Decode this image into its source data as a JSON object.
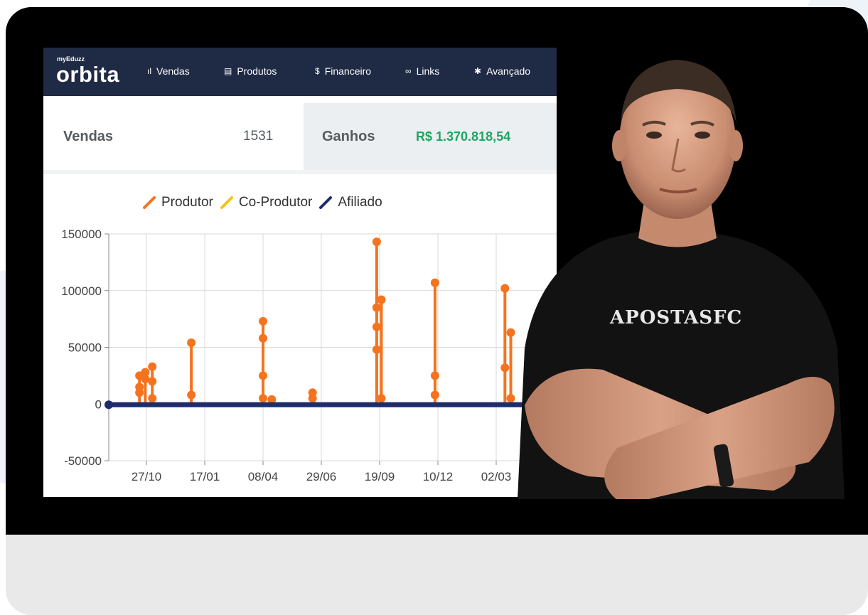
{
  "navbar": {
    "brand_small": "myEduzz",
    "brand": "orbita",
    "items": [
      {
        "icon": "bar-chart-icon",
        "glyph": "ıl",
        "label": "Vendas"
      },
      {
        "icon": "product-icon",
        "glyph": "▤",
        "label": "Produtos"
      },
      {
        "icon": "dollar-icon",
        "glyph": "$",
        "label": "Financeiro"
      },
      {
        "icon": "link-icon",
        "glyph": "∞",
        "label": "Links"
      },
      {
        "icon": "puzzle-icon",
        "glyph": "✱",
        "label": "Avançado"
      }
    ]
  },
  "stats": {
    "sales_label": "Vendas",
    "sales_value": "1531",
    "gains_label": "Ganhos",
    "gains_value": "R$ 1.370.818,54"
  },
  "photo": {
    "shirt_text": "APOSTASFC"
  },
  "colors": {
    "navbar": "#1f2a44",
    "produtor": "#f5731e",
    "coprodutor": "#f7c21b",
    "afiliado": "#1d2d6b",
    "gain": "#1fa463"
  },
  "chart_data": {
    "type": "line",
    "legend": [
      "Produtor",
      "Co-Produtor",
      "Afiliado"
    ],
    "legend_placement": "top",
    "ylim": [
      -50000,
      150000
    ],
    "yticks": [
      -50000,
      0,
      50000,
      100000,
      150000
    ],
    "ytick_labels": [
      "-50000",
      "0",
      "50000",
      "100000",
      "150000"
    ],
    "xtick_labels": [
      "27/10",
      "17/01",
      "08/04",
      "29/06",
      "19/09",
      "10/12",
      "02/03"
    ],
    "grid": true,
    "series": [
      {
        "name": "Produtor",
        "spikes": [
          {
            "x": 0.48,
            "values": [
              0,
              15000,
              25000,
              10000
            ]
          },
          {
            "x": 0.58,
            "values": [
              0,
              28000,
              22000
            ]
          },
          {
            "x": 0.7,
            "values": [
              0,
              33000,
              20000,
              5000
            ]
          },
          {
            "x": 1.37,
            "values": [
              0,
              54000,
              8000,
              0
            ]
          },
          {
            "x": 2.6,
            "values": [
              0,
              73000,
              58000,
              25000,
              5000
            ]
          },
          {
            "x": 2.75,
            "values": [
              0,
              4000
            ]
          },
          {
            "x": 3.45,
            "values": [
              0,
              10000,
              5000
            ]
          },
          {
            "x": 4.55,
            "values": [
              0,
              143000,
              85000,
              68000,
              48000
            ]
          },
          {
            "x": 4.63,
            "values": [
              0,
              92000,
              5000
            ]
          },
          {
            "x": 5.55,
            "values": [
              0,
              107000,
              25000,
              8000
            ]
          },
          {
            "x": 6.75,
            "values": [
              0,
              102000,
              32000
            ]
          },
          {
            "x": 6.85,
            "values": [
              0,
              63000,
              5000
            ]
          }
        ]
      },
      {
        "name": "Co-Produtor",
        "values": [
          0,
          0,
          0,
          0,
          0,
          0,
          0
        ]
      },
      {
        "name": "Afiliado",
        "values": [
          0,
          0,
          0,
          0,
          0,
          0,
          0
        ]
      }
    ]
  }
}
